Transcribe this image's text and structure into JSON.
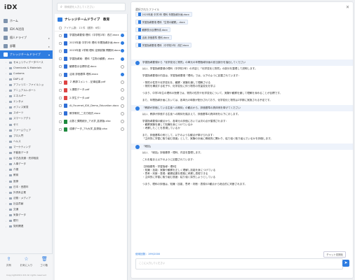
{
  "app": {
    "logo": "iDX"
  },
  "search": {
    "placeholder": "検索語を入力してください"
  },
  "nav": [
    {
      "label": "ホーム",
      "active": false,
      "caret": ""
    },
    {
      "label": "iDX AI活用",
      "active": false,
      "caret": ""
    },
    {
      "label": "個人ドライブ",
      "active": false,
      "caret": "▸"
    },
    {
      "label": "部署",
      "active": false,
      "caret": "▸"
    },
    {
      "label": "ナレッジチームドライブ",
      "active": true,
      "caret": "▾"
    }
  ],
  "tree": [
    "セキュリティデータベース",
    "Chemicals & Materials",
    "Customs",
    "DAPレポ",
    "アフィリエ・ファイルショ",
    "アニュアルレポート",
    "エネルギー",
    "エンタメ",
    "オフィス家賃",
    "スポーツ",
    "スマートアグリ",
    "ゼミ",
    "ファームウェア",
    "プロ入門",
    "ヘルス",
    "マーケティング",
    "不動産データ",
    "中古品流通・売却相談",
    "人事データ",
    "介護",
    "教育",
    "医療",
    "日本・西暦年",
    "外資系企業",
    "法務・メディア",
    "社会貢献",
    "交通",
    "気象データ",
    "銀行",
    "契約関連"
  ],
  "side": {
    "btn1": "共有",
    "btn2": "お気に入り",
    "btn3": "ゴミ箱",
    "copy": "Copyright2021 iDX All rights reserved"
  },
  "filepane": {
    "title": "ナレッジチームドライブ　教育",
    "count": "アイテム数：13 件（選択：6件）"
  },
  "files": [
    {
      "name": "学習指導要領 理科（中学校2年）改訂.docx",
      "color": "#2f6fd6",
      "selected": true
    },
    {
      "name": "2023年度 中学2年 理科 年間指導計画.docx",
      "color": "#2f6fd6",
      "selected": true
    },
    {
      "name": "2023年度 2学期 理科 定期試験 問題例.docx",
      "color": "#2f6fd6",
      "selected": true
    },
    {
      "name": "学習指導案：理科「生物の観察」.docx",
      "color": "#2f6fd6",
      "selected": true
    },
    {
      "name": "観察表示目標作成.docx",
      "color": "#2f6fd6",
      "selected": false
    },
    {
      "name": "活用 評価基準 理科.docx",
      "color": "#2f6fd6",
      "selected": true
    },
    {
      "name": "２.教師コメント - 記事結果.pdf",
      "color": "#d44",
      "selected": false
    },
    {
      "name": "1.課題データ.pdf",
      "color": "#d44",
      "selected": false
    },
    {
      "name": "2.学生データ.pdf",
      "color": "#d44",
      "selected": false
    },
    {
      "name": "AI_Fourmet_IDX_Demo_Education.docx",
      "color": "#2f6fd6",
      "selected": false
    },
    {
      "name": "教学教材_二次方程式.docx",
      "color": "#2f6fd6",
      "selected": false
    },
    {
      "name": "点数と課題統計_ア大学_拡張版.xlsx",
      "color": "#1e8a3e",
      "selected": false
    },
    {
      "name": "成績データ_アA大学_拡張版.xlsx",
      "color": "#1e8a3e",
      "selected": false
    }
  ],
  "chat": {
    "selected_title": "選択されたファイル",
    "chips": [
      "2023年度 中学2年 理科 年間指導計画.docx",
      "学習指導要領 理科「生物の観察」.docx",
      "観察表示目標作成.docx",
      "活用 評価基準 理科.docx",
      "学習指導要領 理科（中学校2年）改訂.docx"
    ],
    "messages": [
      {
        "role": "user",
        "lines": [
          "学習指導要領から「化学変化と物質」の単元の年間指導計画の該当部分を抽出してください"
        ]
      },
      {
        "role": "bot",
        "lines": [
          "はい、学習指導要領の理科（中学校2年）の内容と「化学変化と物質」の部分を整理して説明します。",
          "",
          "学習指導要領の内容は、学習指導要領「理科」では、以下のように記載されています：",
          "",
          "・物質の性質や化学変化を、観察・実験を通して理解させる",
          "・物質を構成する粒子や、化学変化に伴う物質の質量変化を学ぶ",
          "",
          "つまり、中学2年生の理科の授業では、物質の性質や化学変化について、実験や観察を通して理解を深めることが目標です。",
          "",
          "また、年間指導計画においては、各単元の時数が配分されており、化学変化と物質は2学期に実施される予定です。"
        ]
      },
      {
        "role": "user",
        "lines": [
          "「教師が評価している生徒への期待」の観点から、評価基準の具体例を挙げてください"
        ]
      },
      {
        "role": "bot",
        "lines": [
          "はい、教師が評価する生徒への期待を踏まえて、評価基準の具体例を以下に示します。",
          "",
          "学習指導要領の観点から、各単元の評価においては次の点が重視されます：",
          "・観察実験を通して知識を身につけているか",
          "・考察したことを表現しているか",
          "",
          "また、評価基準の例として、以下のような観点が挙げられます：",
          "「主体的に学習に取り組む態度」として、実験の計画に積極的に関わり、粘り強く取り組んでいるかを評価します。"
        ]
      },
      {
        "role": "user",
        "lines": [
          "「総括」"
        ]
      },
      {
        "role": "bot",
        "lines": [
          "はい、「総括」評価基準・理科、内容を整理します。",
          "",
          "これを踏まえ以下のように記載されています：",
          "",
          "【評価基準・学習指導・理科】",
          "・知識・技能：実験や観察を正しく理解し技能を身につけている",
          "・思考・判断・表現：観察結果を根拠に考察し表現できる",
          "・主体的に学習に取り組む態度：粘り強く探究しようとしている",
          "",
          "つまり、理科の評価は、知識・技能、思考・判断・表現の3観点から総合的に判断されます。"
        ]
      }
    ],
    "meta": "使用回数：199/2000",
    "clear": "チャット初期化",
    "input_placeholder": "ここに入力してください"
  }
}
